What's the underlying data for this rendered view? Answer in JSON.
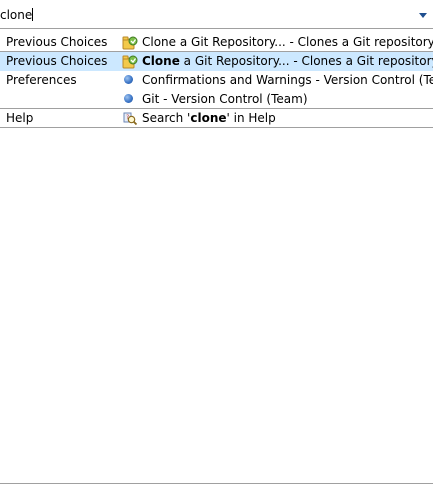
{
  "search": {
    "value": "clone",
    "dropdown_icon": "chevron-down-icon"
  },
  "results": [
    {
      "category": "Previous Choices",
      "icon": "git-clone-icon",
      "prefix": "",
      "bold": "",
      "text": "Clone a Git Repository... - Clones a Git repository and",
      "selected": false
    },
    {
      "category": "Previous Choices",
      "icon": "git-clone-icon",
      "prefix": "",
      "bold": "Clone",
      "text": " a Git Repository... - Clones a Git repository and",
      "selected": true
    },
    {
      "category": "Preferences",
      "icon": "preference-bullet-icon",
      "prefix": "",
      "bold": "",
      "text": "Confirmations and Warnings - Version Control (Team)",
      "selected": false
    },
    {
      "category": "",
      "icon": "preference-bullet-icon",
      "prefix": "",
      "bold": "",
      "text": "Git - Version Control (Team)",
      "selected": false
    },
    {
      "category": "Help",
      "icon": "help-search-icon",
      "prefix": "Search '",
      "bold": "clone",
      "text": "' in Help",
      "selected": false
    }
  ],
  "colors": {
    "selection": "#cce8ff",
    "divider": "#a0a0a0",
    "accent": "#1f4f8f"
  }
}
